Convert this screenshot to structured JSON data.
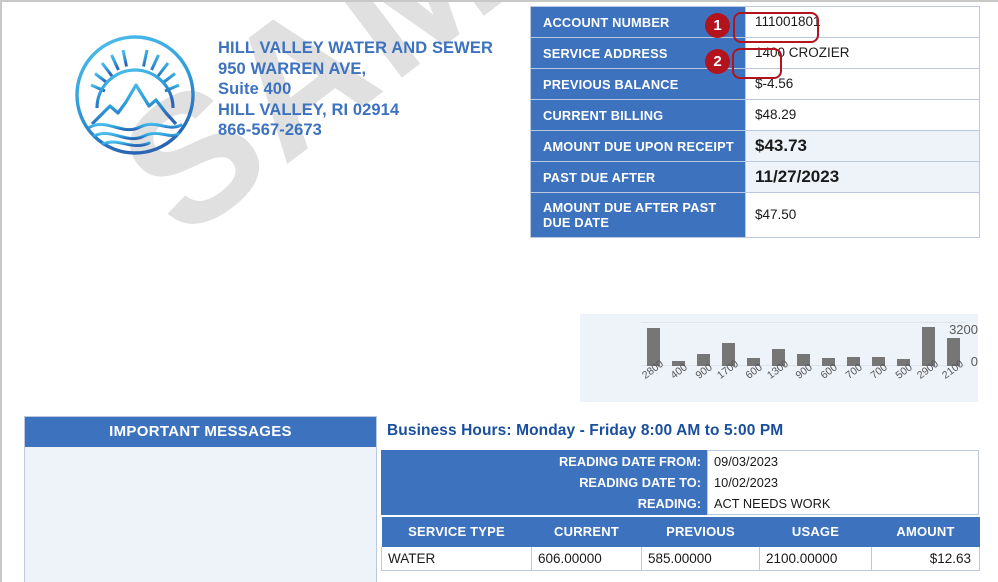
{
  "company": {
    "logo_icon": "sun-mountain-water-circle-logo",
    "name": "HILL VALLEY WATER AND SEWER",
    "address_line1": "950 WARREN AVE,",
    "address_line2": "Suite 400",
    "address_line3": "HILL VALLEY, RI 02914",
    "phone": "866-567-2673"
  },
  "summary": {
    "rows": [
      {
        "label": "ACCOUNT NUMBER",
        "value": "111001801",
        "highlight": false,
        "big": false
      },
      {
        "label": "SERVICE ADDRESS",
        "value": "1400 CROZIER",
        "highlight": false,
        "big": false
      },
      {
        "label": "PREVIOUS BALANCE",
        "value": "$-4.56",
        "highlight": false,
        "big": false
      },
      {
        "label": "CURRENT BILLING",
        "value": "$48.29",
        "highlight": false,
        "big": false
      },
      {
        "label": "AMOUNT DUE UPON RECEIPT",
        "value": "$43.73",
        "highlight": true,
        "big": true
      },
      {
        "label": "PAST DUE AFTER",
        "value": "11/27/2023",
        "highlight": true,
        "big": true
      },
      {
        "label": "AMOUNT DUE AFTER PAST DUE DATE",
        "value": "$47.50",
        "highlight": false,
        "big": false
      }
    ]
  },
  "annotations": [
    {
      "number": "1",
      "target": "account-number-value"
    },
    {
      "number": "2",
      "target": "service-address-street-number"
    }
  ],
  "chart_data": {
    "type": "bar",
    "title": "",
    "xlabel": "",
    "ylabel": "",
    "categories": [
      "2800",
      "400",
      "900",
      "1700",
      "600",
      "1300",
      "900",
      "600",
      "700",
      "700",
      "500",
      "2900",
      "2100"
    ],
    "values": [
      2800,
      400,
      900,
      1700,
      600,
      1300,
      900,
      600,
      700,
      700,
      500,
      2900,
      2100
    ],
    "ytick_labels": [
      "3200",
      "0"
    ],
    "ylim": [
      0,
      3200
    ],
    "grid": true,
    "legend": false,
    "bar_color": "#767676"
  },
  "messages": {
    "header": "IMPORTANT MESSAGES",
    "body": ""
  },
  "business_hours": "Business Hours: Monday - Friday 8:00 AM to 5:00 PM",
  "reading": {
    "rows": [
      {
        "label": "READING DATE FROM:",
        "value": "09/03/2023"
      },
      {
        "label": "READING DATE TO:",
        "value": "10/02/2023"
      },
      {
        "label": "READING:",
        "value": "ACT NEEDS WORK"
      }
    ]
  },
  "service_table": {
    "headers": [
      "SERVICE TYPE",
      "CURRENT",
      "PREVIOUS",
      "USAGE",
      "AMOUNT"
    ],
    "rows": [
      {
        "service_type": "WATER",
        "current": "606.00000",
        "previous": "585.00000",
        "usage": "2100.00000",
        "amount": "$12.63"
      }
    ]
  },
  "watermark": {
    "text": "SAMPLE",
    "color": "#e0e0e0"
  },
  "colors": {
    "brand_blue": "#3d72bf",
    "heading_navy": "#1a4fa0",
    "annotation_red": "#b3131c",
    "panel_tint": "#eef2f9"
  }
}
